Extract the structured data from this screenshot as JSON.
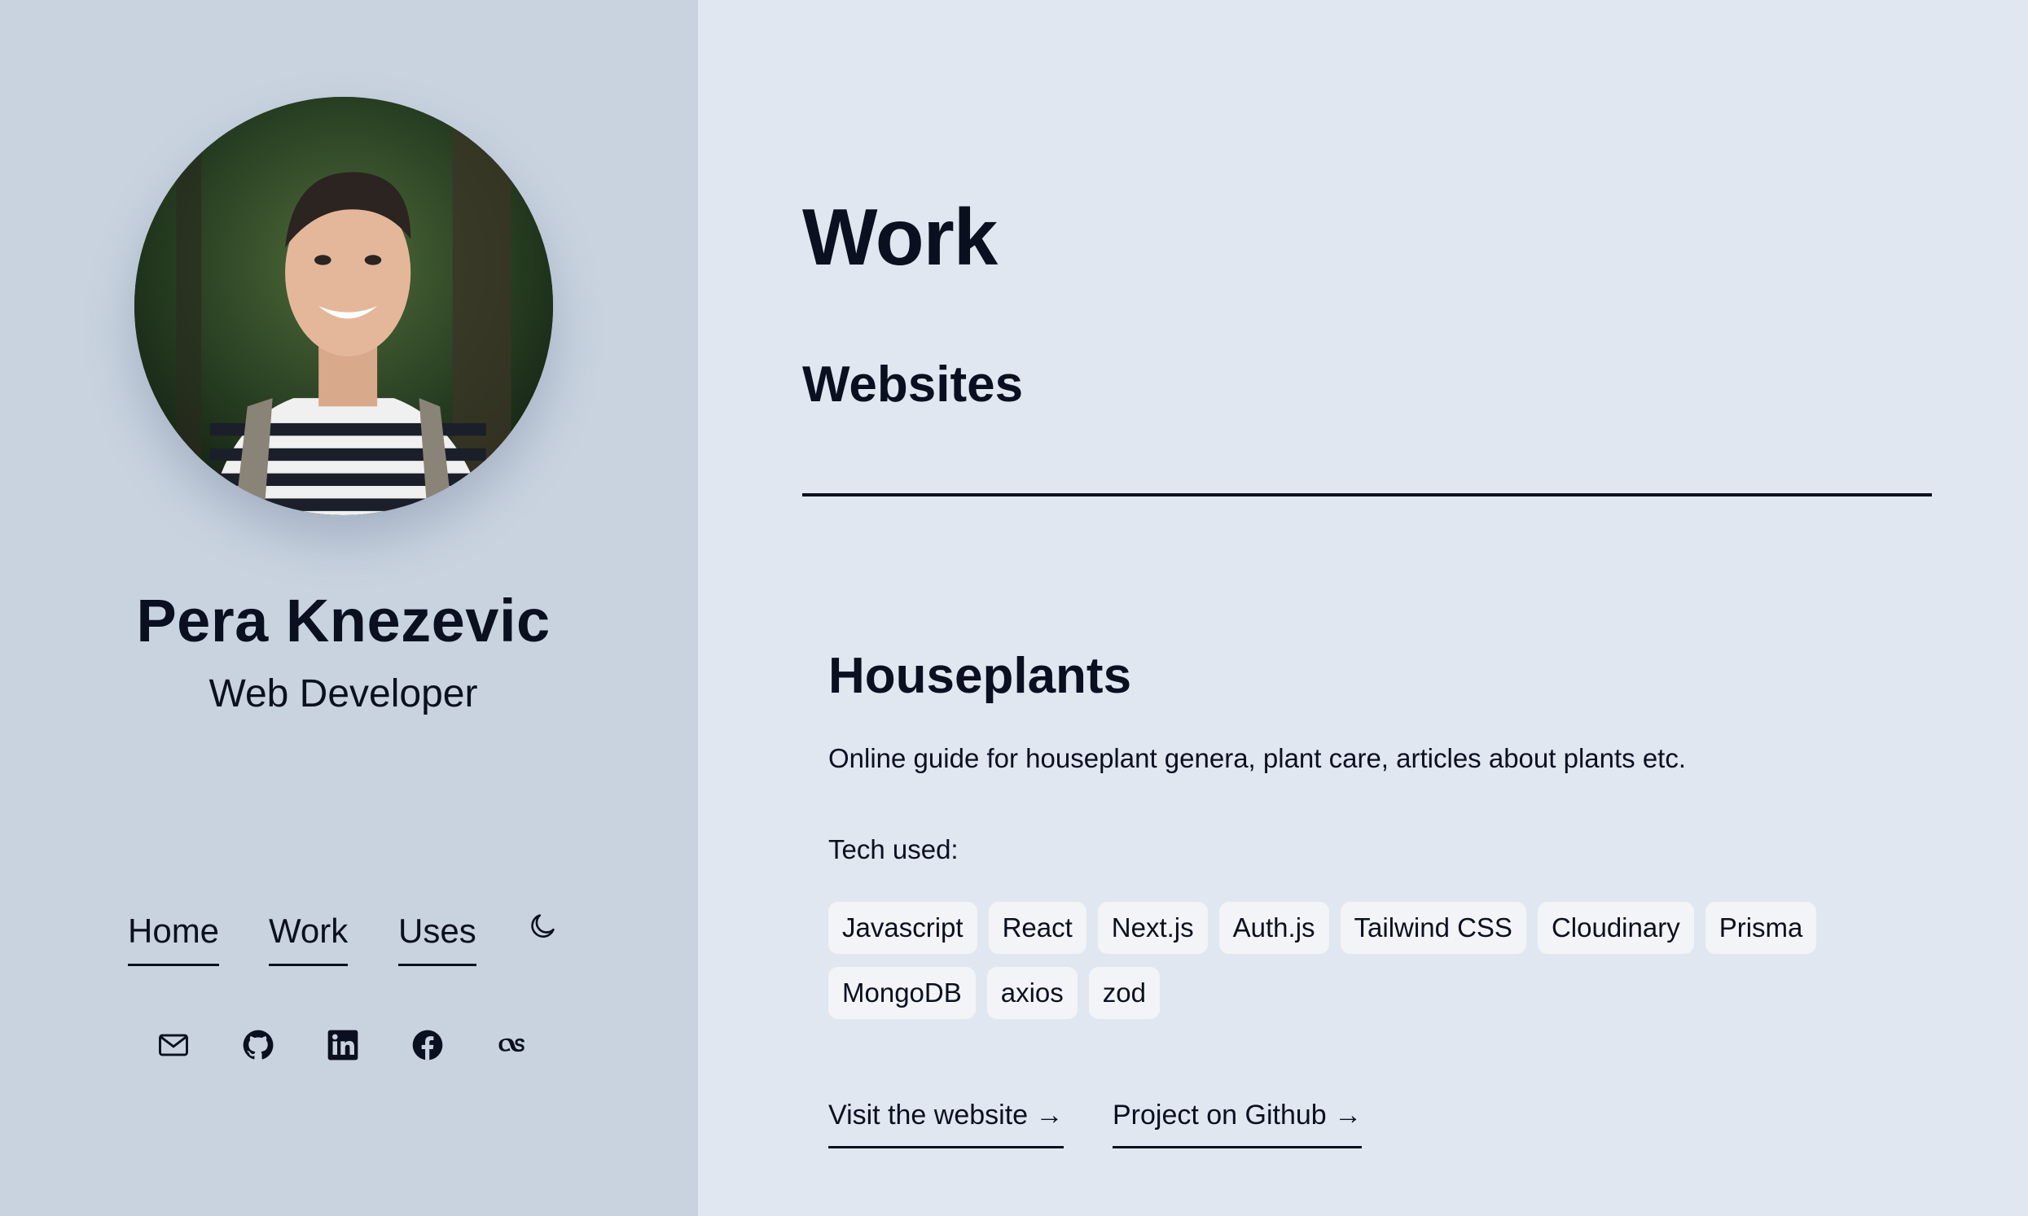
{
  "profile": {
    "name": "Pera Knezevic",
    "role": "Web Developer"
  },
  "nav": {
    "items": [
      {
        "label": "Home"
      },
      {
        "label": "Work"
      },
      {
        "label": "Uses"
      }
    ],
    "theme_icon": "moon-icon"
  },
  "social": {
    "icons": [
      "mail-icon",
      "github-icon",
      "linkedin-icon",
      "facebook-icon",
      "lastfm-icon"
    ]
  },
  "page": {
    "title": "Work",
    "section": "Websites"
  },
  "project": {
    "title": "Houseplants",
    "description": "Online guide for houseplant genera, plant care, articles about plants etc.",
    "tech_label": "Tech used:",
    "tech": [
      "Javascript",
      "React",
      "Next.js",
      "Auth.js",
      "Tailwind CSS",
      "Cloudinary",
      "Prisma",
      "MongoDB",
      "axios",
      "zod"
    ],
    "links": [
      {
        "label": "Visit the website →"
      },
      {
        "label": "Project on Github →"
      }
    ]
  },
  "colors": {
    "sidebar_bg": "#c9d3e0",
    "main_bg": "#e1e7f0",
    "text": "#0b1020",
    "tag_bg": "#f2f4f7"
  }
}
